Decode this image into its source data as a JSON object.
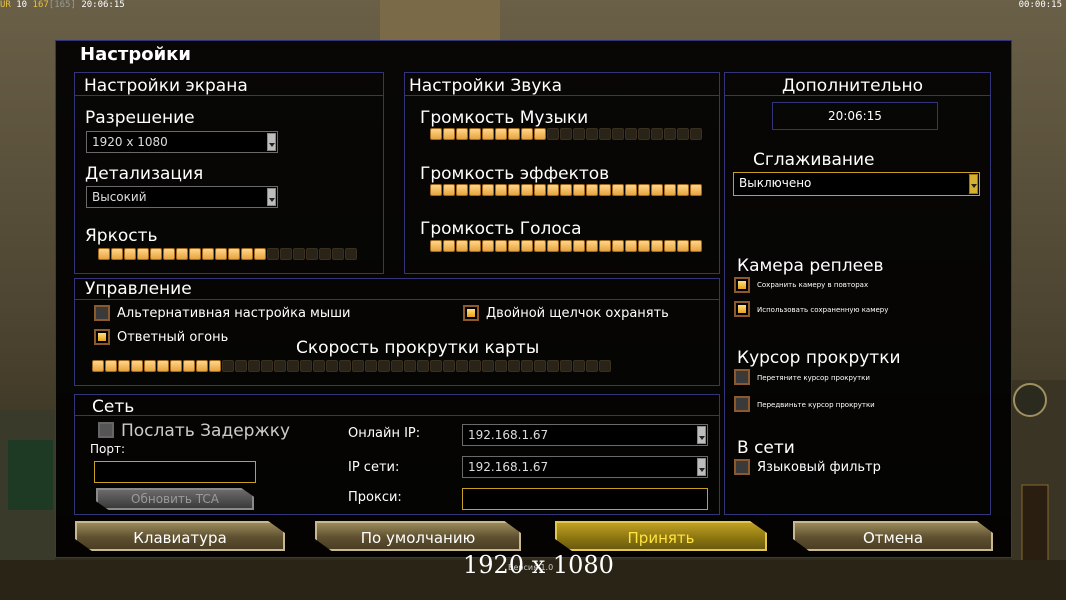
{
  "hud": {
    "top_left_prefix": "UR",
    "top_left_a": "10",
    "top_left_b": "167",
    "top_left_c": "[165]",
    "top_left_time": "20:06:15",
    "top_right_time": "00:00:15"
  },
  "title": "Настройки",
  "display": {
    "title": "Настройки экрана",
    "resolution_label": "Разрешение",
    "resolution_value": "1920 x 1080",
    "detail_label": "Детализация",
    "detail_value": "Высокий",
    "brightness_label": "Яркость",
    "brightness_level": {
      "filled": 13,
      "total": 20
    }
  },
  "sound": {
    "title": "Настройки Звука",
    "music_label": "Громкость Музыки",
    "music_level": {
      "filled": 9,
      "total": 21
    },
    "effects_label": "Громкость эффектов",
    "effects_level": {
      "filled": 21,
      "total": 21
    },
    "voice_label": "Громкость Голоса",
    "voice_level": {
      "filled": 21,
      "total": 21
    }
  },
  "advanced": {
    "title": "Дополнительно",
    "clock": "20:06:15",
    "aa_label": "Сглаживание",
    "aa_value": "Выключено",
    "replay_camera_title": "Камера реплеев",
    "replay_opt1": "Сохранить камеру в повторах",
    "replay_opt2": "Использовать сохраненную камеру",
    "scroll_cursor_title": "Курсор прокрутки",
    "scroll_opt1": "Перетяните курсор прокрутки",
    "scroll_opt2": "Передвиньте курсор прокрутки",
    "online_title": "В сети",
    "language_filter": "Языковый фильтр"
  },
  "controls": {
    "title": "Управление",
    "alt_mouse": "Альтернативная настройка мыши",
    "double_click": "Двойной щелчок охранять",
    "return_fire": "Ответный огонь",
    "scroll_speed_label": "Скорость прокрутки карты",
    "scroll_speed_level": {
      "filled": 10,
      "total": 40
    }
  },
  "network": {
    "title": "Сеть",
    "send_delay": "Послать Задержку",
    "port_label": "Порт:",
    "update_tca": "Обновить TCA",
    "online_ip_label": "Онлайн IP:",
    "online_ip_value": "192.168.1.67",
    "lan_ip_label": "IP сети:",
    "lan_ip_value": "192.168.1.67",
    "proxy_label": "Прокси:"
  },
  "buttons": {
    "keyboard": "Клавиатура",
    "defaults": "По умолчанию",
    "accept": "Принять",
    "cancel": "Отмена"
  },
  "footer": {
    "resolution": "1920 x 1080",
    "version": "Версия 1.0"
  },
  "colors": {
    "panel_border": "#34347a",
    "accent_gold": "#c8a020",
    "slider_on": "#f0b050"
  }
}
